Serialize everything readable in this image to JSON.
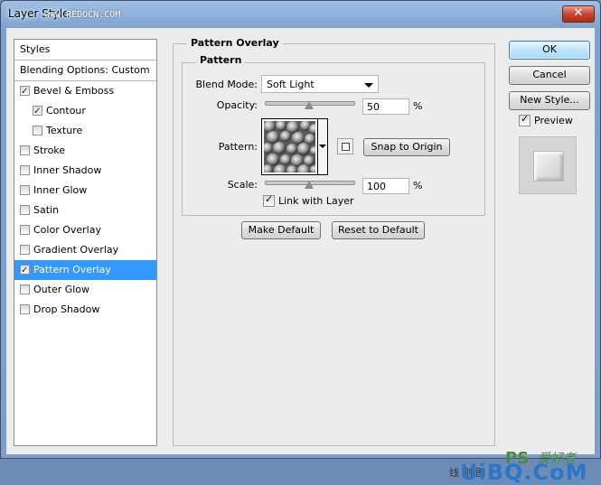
{
  "window": {
    "title": "Layer Style",
    "watermark_top": "www.REDOCN.COM",
    "close_symbol": "✕"
  },
  "left_panel": {
    "styles_label": "Styles",
    "blending_label": "Blending Options: Custom",
    "items": [
      {
        "label": "Bevel & Emboss",
        "checked": true,
        "indent": false,
        "selected": false
      },
      {
        "label": "Contour",
        "checked": true,
        "indent": true,
        "selected": false
      },
      {
        "label": "Texture",
        "checked": false,
        "indent": true,
        "selected": false
      },
      {
        "label": "Stroke",
        "checked": false,
        "indent": false,
        "selected": false
      },
      {
        "label": "Inner Shadow",
        "checked": false,
        "indent": false,
        "selected": false
      },
      {
        "label": "Inner Glow",
        "checked": false,
        "indent": false,
        "selected": false
      },
      {
        "label": "Satin",
        "checked": false,
        "indent": false,
        "selected": false
      },
      {
        "label": "Color Overlay",
        "checked": false,
        "indent": false,
        "selected": false
      },
      {
        "label": "Gradient Overlay",
        "checked": false,
        "indent": false,
        "selected": false
      },
      {
        "label": "Pattern Overlay",
        "checked": true,
        "indent": false,
        "selected": true
      },
      {
        "label": "Outer Glow",
        "checked": false,
        "indent": false,
        "selected": false
      },
      {
        "label": "Drop Shadow",
        "checked": false,
        "indent": false,
        "selected": false
      }
    ]
  },
  "pattern_overlay": {
    "section_title": "Pattern Overlay",
    "group_title": "Pattern",
    "blend_mode_label": "Blend Mode:",
    "blend_mode_value": "Soft Light",
    "opacity_label": "Opacity:",
    "opacity_value": "50",
    "opacity_unit": "%",
    "opacity_fraction": 0.5,
    "pattern_label": "Pattern:",
    "snap_button": "Snap to Origin",
    "scale_label": "Scale:",
    "scale_value": "100",
    "scale_unit": "%",
    "link_label": "Link with Layer",
    "link_checked": true,
    "make_default_button": "Make Default",
    "reset_default_button": "Reset to Default"
  },
  "right_panel": {
    "ok_button": "OK",
    "cancel_button": "Cancel",
    "new_style_button": "New Style...",
    "preview_label": "Preview",
    "preview_checked": true
  },
  "watermark_bottom": {
    "ps_text": "PS",
    "chinese_text": "爱好者",
    "brand": "UiBQ.CoM",
    "small_text": "线 剧 图"
  },
  "colors": {
    "selection": "#3399ff",
    "dialog_bg": "#ececec",
    "titlebar": "#7fa3cf",
    "close_button": "#c8452c"
  }
}
